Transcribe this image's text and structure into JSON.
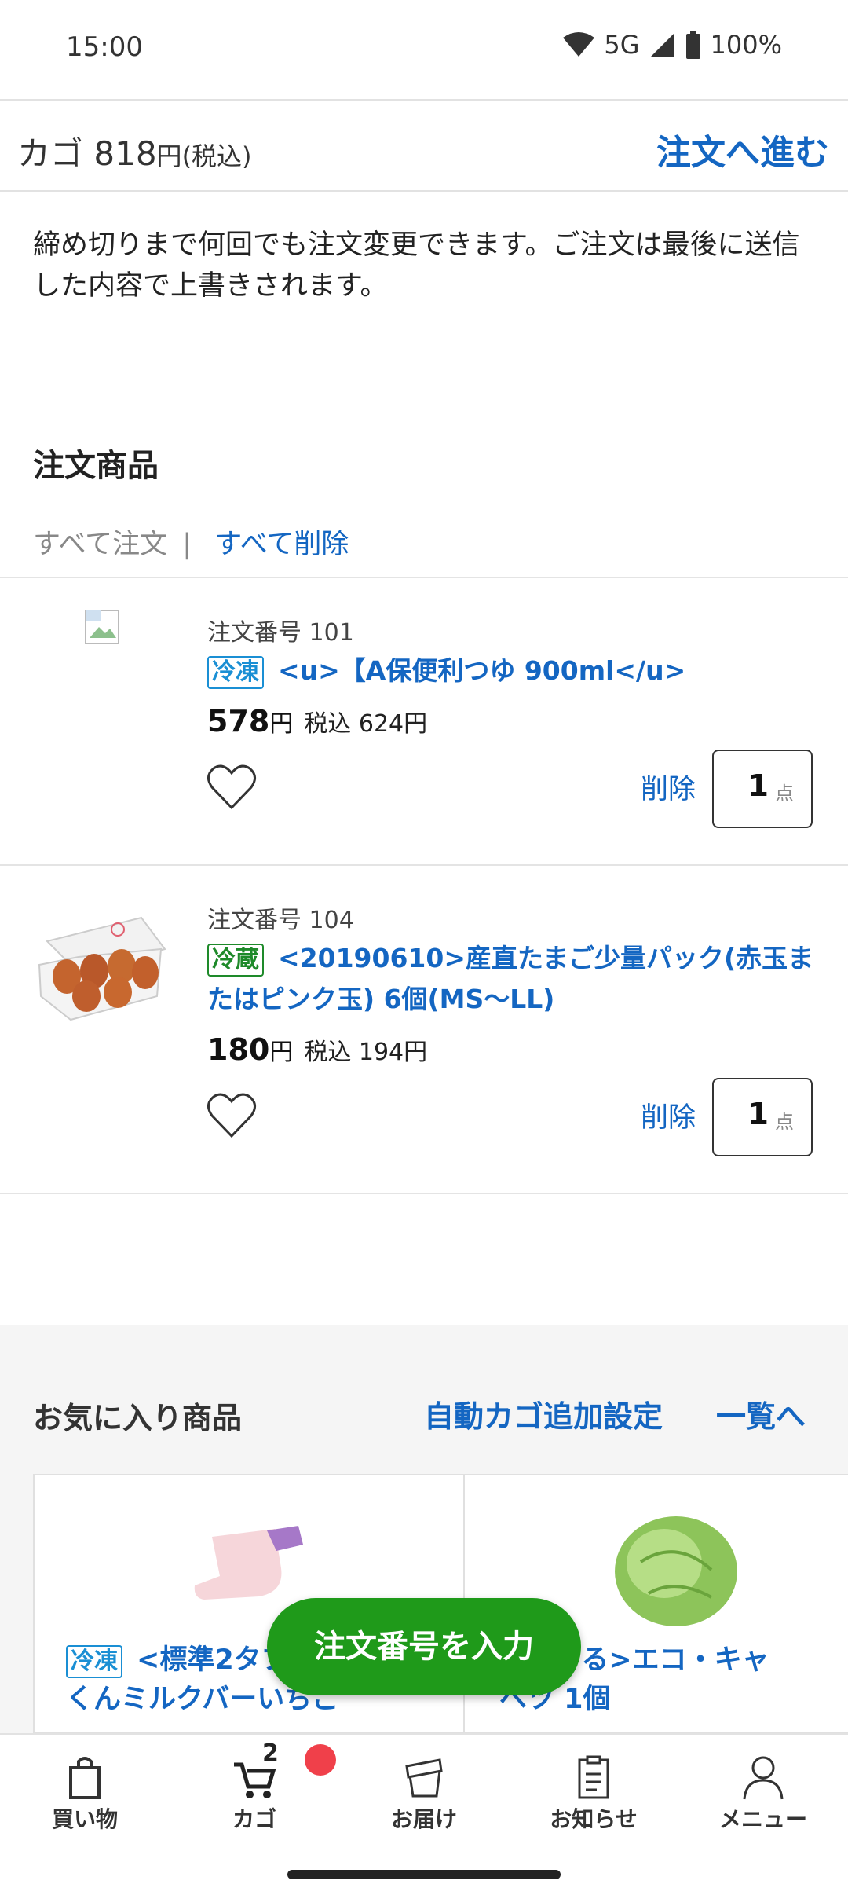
{
  "status": {
    "time": "15:00",
    "network": "5G",
    "battery": "100%"
  },
  "cart": {
    "label": "カゴ",
    "amount": "818",
    "yen": "円",
    "tax_note": "(税込)",
    "proceed": "注文へ進む"
  },
  "notice": "締め切りまで何回でも注文変更できます。ご注文は最後に送信した内容で上書きされます。",
  "section_title": "注文商品",
  "bulk": {
    "order_all": "すべて注文",
    "separator": "|",
    "delete_all": "すべて削除"
  },
  "items": [
    {
      "order_no": "注文番号 101",
      "tag": "冷凍",
      "name": "<u>【A保便利つゆ 900ml</u>",
      "price": "578",
      "yen": "円",
      "tax": "税込 624円",
      "delete": "削除",
      "qty": "1",
      "unit": "点"
    },
    {
      "order_no": "注文番号 104",
      "tag": "冷蔵",
      "name": "<20190610>産直たまご少量パック(赤玉またはピンク玉) 6個(MS〜LL)",
      "price": "180",
      "yen": "円",
      "tax": "税込 194円",
      "delete": "削除",
      "qty": "1",
      "unit": "点"
    }
  ],
  "favorites": {
    "title": "お気に入り商品",
    "auto_add": "自動カゴ追加設定",
    "view_all": "一覧へ",
    "cards": [
      {
        "tag": "冷凍",
        "name": "<標準2タブ",
        "name_line2": "くんミルクバーいちご"
      },
      {
        "name": "パルくる>エコ・キャ",
        "name_line2": "ベツ 1個"
      }
    ]
  },
  "fab": "注文番号を入力",
  "nav": {
    "items": [
      {
        "label": "買い物",
        "icon": "shopping-bag-icon"
      },
      {
        "label": "カゴ",
        "icon": "cart-icon",
        "count": "2"
      },
      {
        "label": "お届け",
        "icon": "delivery-box-icon"
      },
      {
        "label": "お知らせ",
        "icon": "clipboard-icon"
      },
      {
        "label": "メニュー",
        "icon": "person-icon"
      }
    ]
  },
  "colors": {
    "link": "#1466c2",
    "frozen": "#1a8fd4",
    "chilled": "#1e8a2a",
    "fab": "#1f9a1a",
    "badge": "#f0404a"
  }
}
